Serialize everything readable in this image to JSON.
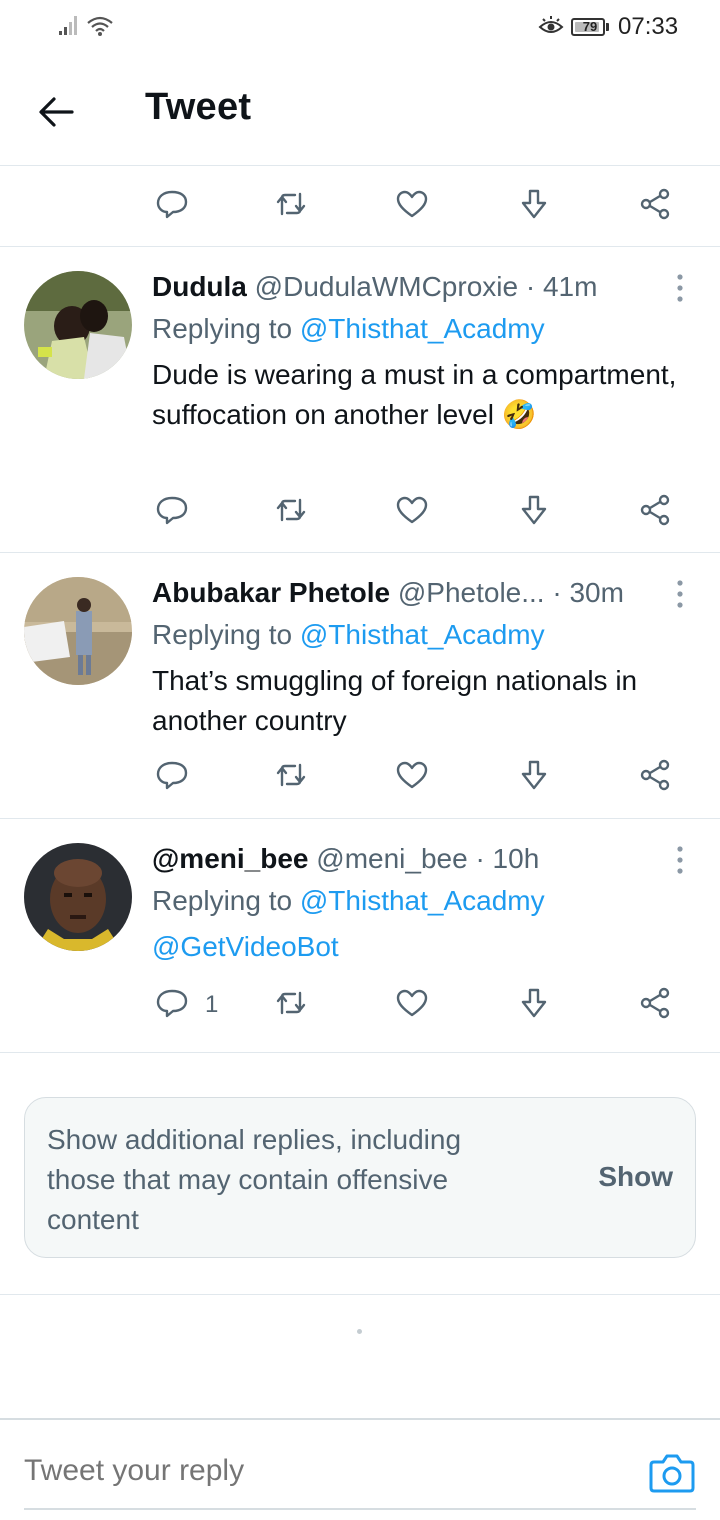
{
  "status_bar": {
    "battery": "79",
    "time": "07:33"
  },
  "header": {
    "title": "Tweet"
  },
  "colors": {
    "link": "#1d9bf0",
    "secondary_text": "#536471",
    "primary_text": "#0f1419"
  },
  "tweets": [
    {
      "name": "Dudula",
      "handle": "@DudulaWMCproxie",
      "time": "· 41m",
      "replying_prefix": "Replying to",
      "replying_to": "@Thisthat_Acadmy",
      "text": "Dude is wearing a must in a compartment, suffocation on another level 🤣",
      "reply_count": ""
    },
    {
      "name": "Abubakar Phetole",
      "handle": "@Phetole...",
      "time": "· 30m",
      "replying_prefix": "Replying to",
      "replying_to": "@Thisthat_Acadmy",
      "text": "That’s smuggling of foreign nationals in another country",
      "reply_count": ""
    },
    {
      "name": "@meni_bee",
      "handle": "@meni_bee",
      "time": "· 10h",
      "replying_prefix": "Replying to",
      "replying_to": "@Thisthat_Acadmy",
      "text": "@GetVideoBot",
      "reply_count": "1"
    }
  ],
  "more_replies": {
    "text": "Show additional replies, including those that may contain offensive content",
    "button": "Show"
  },
  "composer": {
    "placeholder": "Tweet your reply"
  }
}
